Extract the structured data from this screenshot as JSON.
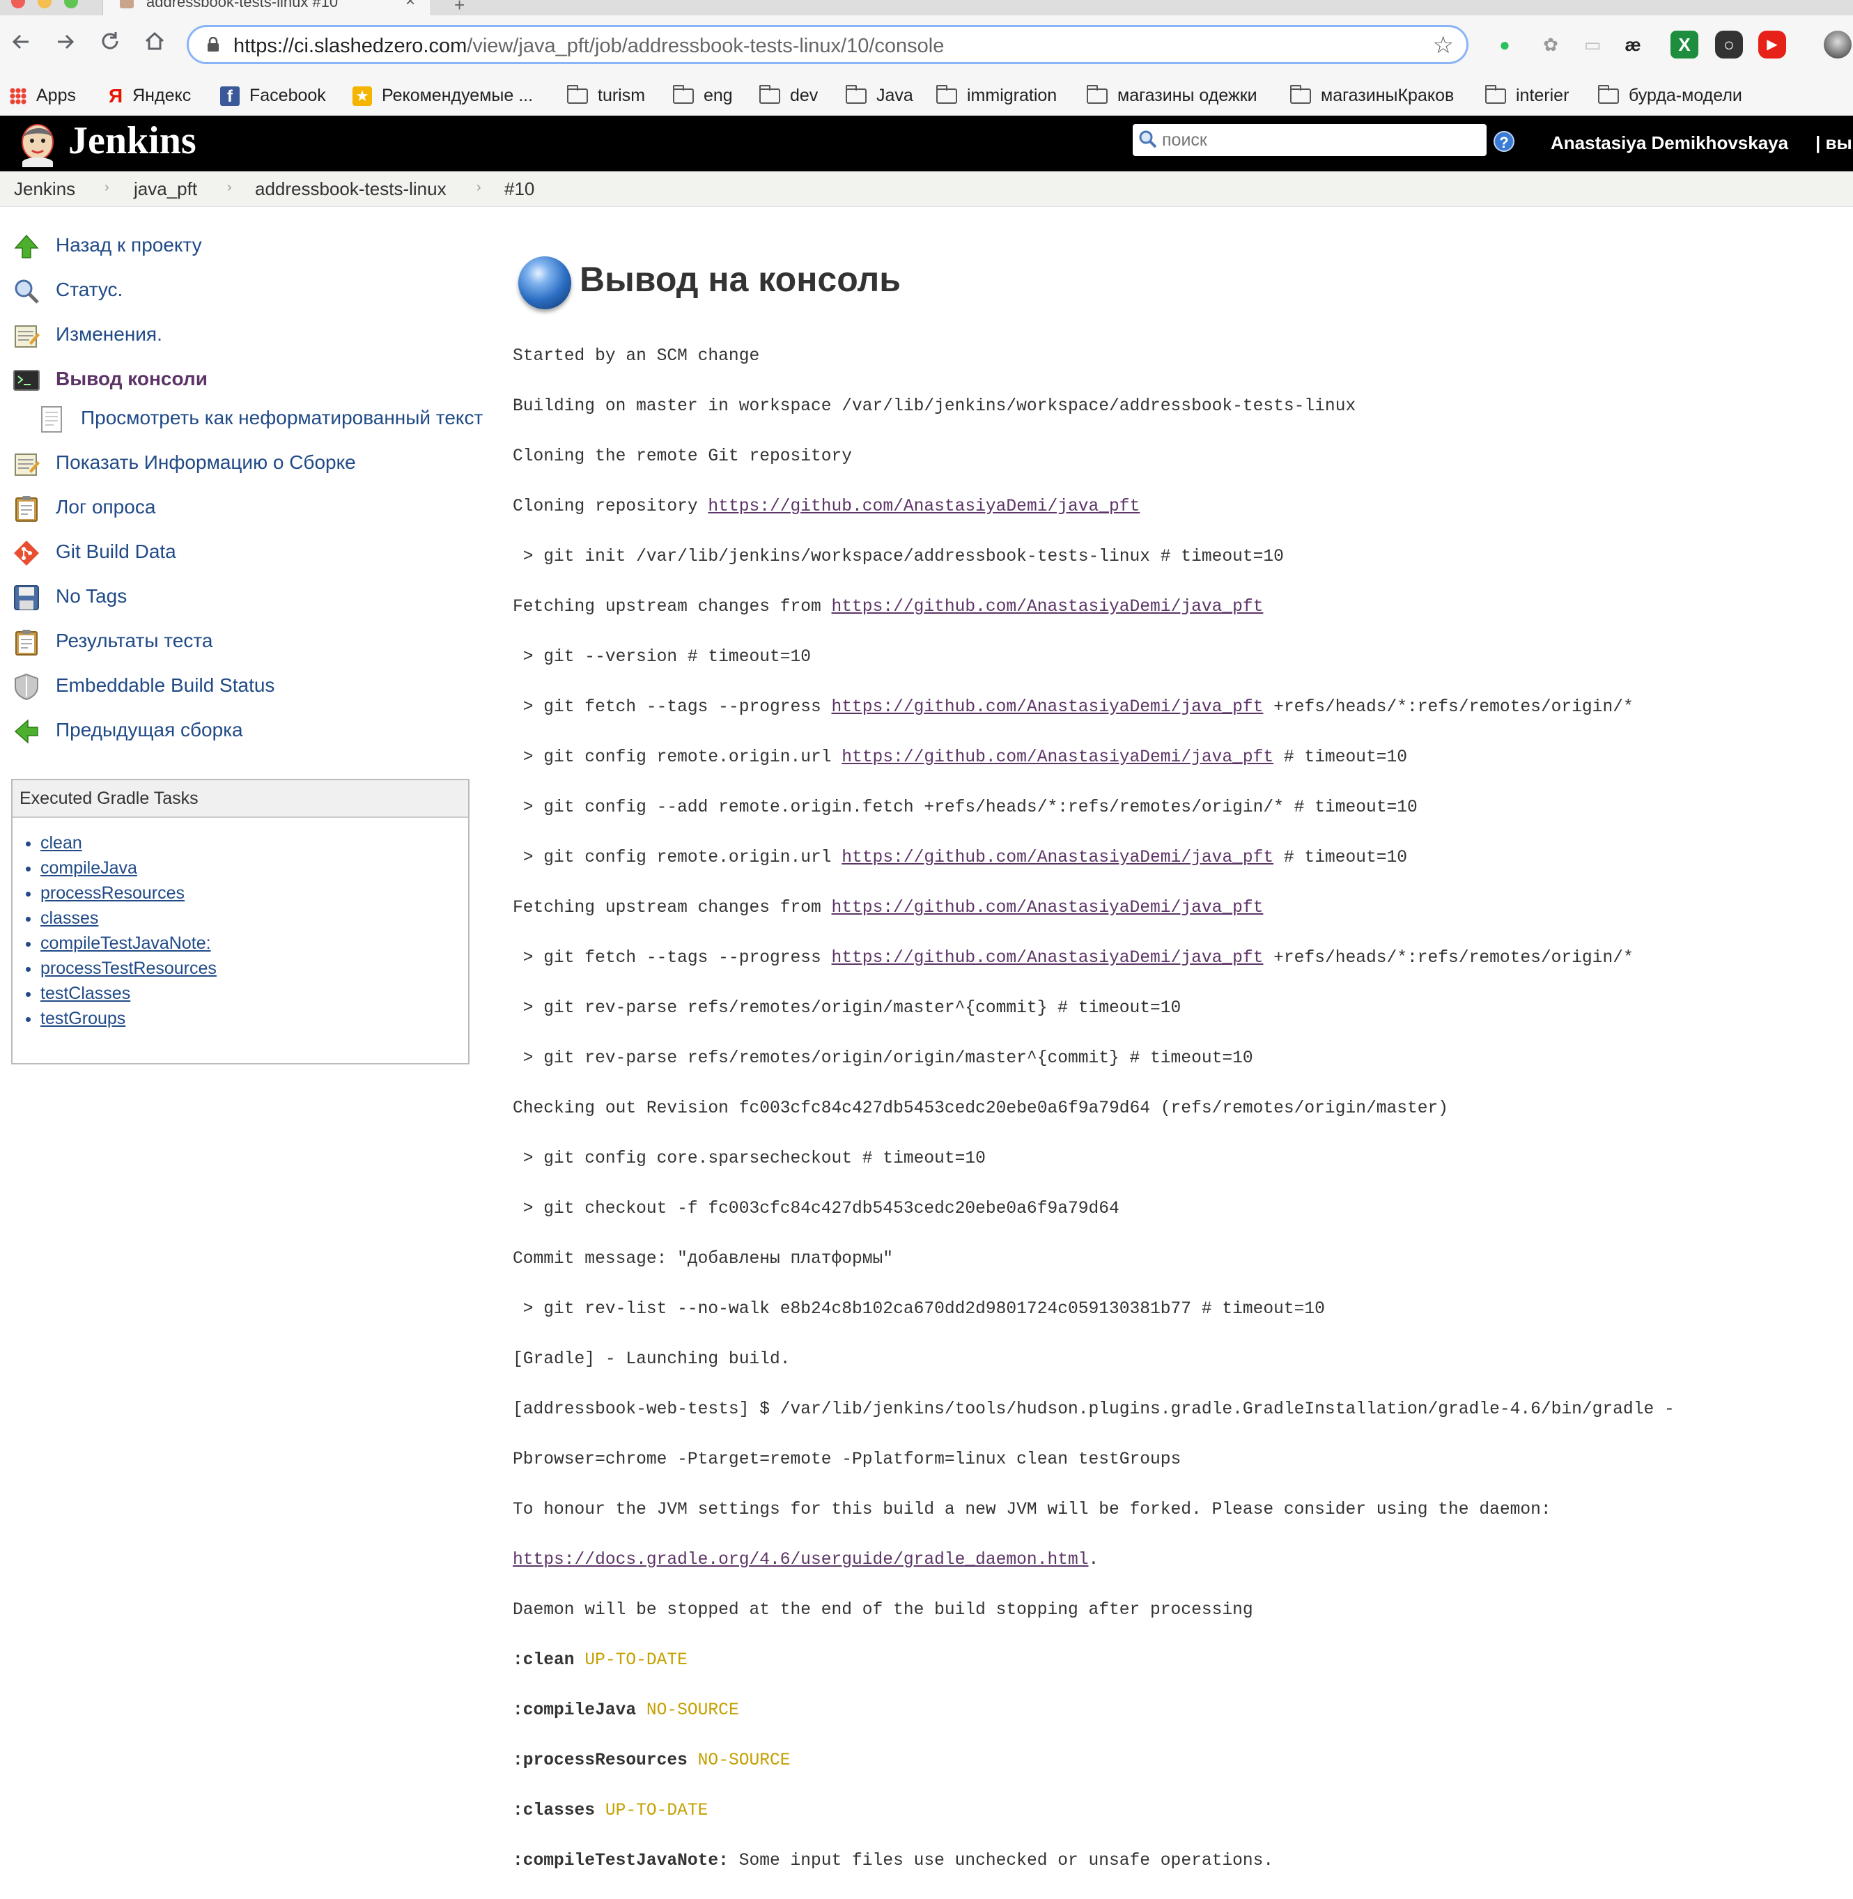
{
  "browser": {
    "tab_title": "addressbook-tests-linux #10",
    "url_host": "https://ci.slashedzero.com",
    "url_path": "/view/java_pft/job/addressbook-tests-linux/10/console",
    "bookmarks": [
      "Apps",
      "Яндекс",
      "Facebook",
      "Рекомендуемые ...",
      "turism",
      "eng",
      "dev",
      "Java",
      "immigration",
      "магазины одежки",
      "магазиныКраков",
      "interier",
      "бурда-модели"
    ]
  },
  "header": {
    "logo_text": "Jenkins",
    "search_placeholder": "поиск",
    "help": "?",
    "user": "Anastasiya Demikhovskaya",
    "logout": "| вы"
  },
  "breadcrumbs": [
    "Jenkins",
    "java_pft",
    "addressbook-tests-linux",
    "#10"
  ],
  "sidebar": {
    "tasks": [
      "Назад к проекту",
      "Статус.",
      "Изменения.",
      "Вывод консоли",
      "Просмотреть как неформатированный текст",
      "Показать Информацию о Сборке",
      "Лог опроса",
      "Git Build Data",
      "No Tags",
      "Результаты теста",
      "Embeddable Build Status",
      "Предыдущая сборка"
    ],
    "gradle_title": "Executed Gradle Tasks",
    "gradle_tasks": [
      "clean",
      "compileJava",
      "processResources",
      "classes",
      "compileTestJavaNote:",
      "processTestResources",
      "testClasses",
      "testGroups"
    ]
  },
  "main": {
    "title": "Вывод на консоль",
    "console": [
      "Started by an SCM change",
      "Building on master in workspace /var/lib/jenkins/workspace/addressbook-tests-linux",
      "Cloning the remote Git repository",
      "Cloning repository ",
      "https://github.com/AnastasiyaDemi/java_pft",
      " > git init /var/lib/jenkins/workspace/addressbook-tests-linux # timeout=10",
      "Fetching upstream changes from ",
      " > git --version # timeout=10",
      " > git fetch --tags --progress ",
      " +refs/heads/*:refs/remotes/origin/*",
      " > git config remote.origin.url ",
      " # timeout=10",
      " > git config --add remote.origin.fetch +refs/heads/*:refs/remotes/origin/* # timeout=10",
      " > git rev-parse refs/remotes/origin/master^{commit} # timeout=10",
      " > git rev-parse refs/remotes/origin/origin/master^{commit} # timeout=10",
      "Checking out Revision fc003cfc84c427db5453cedc20ebe0a6f9a79d64 (refs/remotes/origin/master)",
      " > git config core.sparsecheckout # timeout=10",
      " > git checkout -f fc003cfc84c427db5453cedc20ebe0a6f9a79d64",
      "Commit message: \"добавлены платформы\"",
      " > git rev-list --no-walk e8b24c8b102ca670dd2d9801724c059130381b77 # timeout=10",
      "[Gradle] - Launching build.",
      "[addressbook-web-tests] $ /var/lib/jenkins/tools/hudson.plugins.gradle.GradleInstallation/gradle-4.6/bin/gradle -",
      "Pbrowser=chrome -Ptarget=remote -Pplatform=linux clean testGroups",
      "To honour the JVM settings for this build a new JVM will be forked. Please consider using the daemon:",
      "https://docs.gradle.org/4.6/userguide/gradle_daemon.html",
      ".",
      "Daemon will be stopped at the end of the build stopping after processing",
      ":clean",
      "UP-TO-DATE",
      ":compileJava",
      "NO-SOURCE",
      ":processResources",
      ":classes",
      ":compileTestJavaNote:",
      " Some input files use unchecked or unsafe operations."
    ]
  }
}
